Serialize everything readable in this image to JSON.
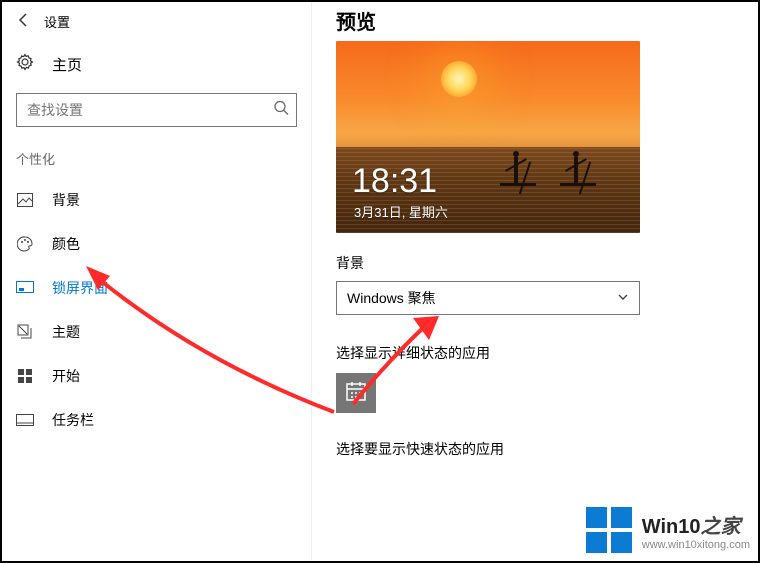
{
  "sidebar": {
    "back_label": "设置",
    "home_label": "主页",
    "search_placeholder": "查找设置",
    "section_label": "个性化",
    "items": [
      {
        "label": "背景"
      },
      {
        "label": "颜色"
      },
      {
        "label": "锁屏界面"
      },
      {
        "label": "主题"
      },
      {
        "label": "开始"
      },
      {
        "label": "任务栏"
      }
    ]
  },
  "main": {
    "title": "预览",
    "preview": {
      "time": "18:31",
      "date": "3月31日, 星期六"
    },
    "background": {
      "label": "背景",
      "selected": "Windows 聚焦"
    },
    "detailed_status_label": "选择显示详细状态的应用",
    "quick_status_label": "选择要显示快速状态的应用"
  },
  "watermark": {
    "brand1": "Win10",
    "brand2": "之家",
    "url": "www.win10xitong.com"
  }
}
